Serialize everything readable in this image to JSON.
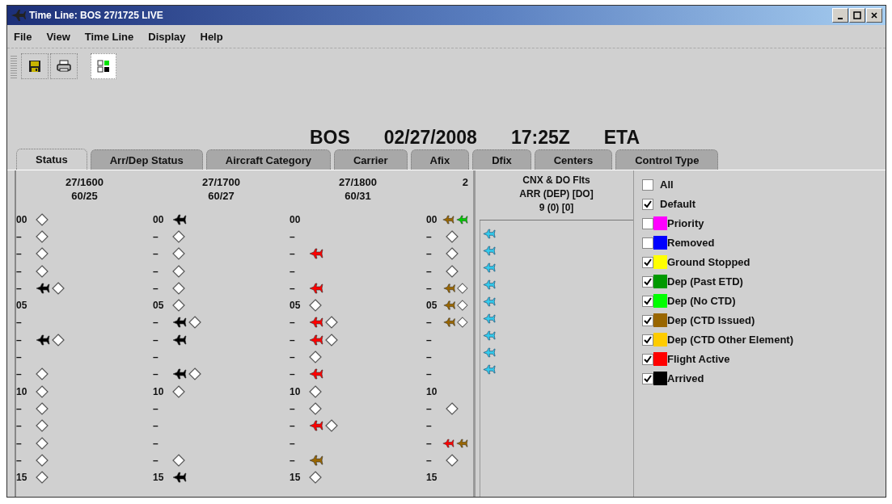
{
  "window": {
    "title": "Time Line: BOS 27/1725 LIVE"
  },
  "menu": [
    "File",
    "View",
    "Time Line",
    "Display",
    "Help"
  ],
  "header": [
    "BOS",
    "02/27/2008",
    "17:25Z",
    "ETA"
  ],
  "tabs": [
    {
      "label": "Status",
      "selected": true
    },
    {
      "label": "Arr/Dep Status",
      "selected": false
    },
    {
      "label": "Aircraft Category",
      "selected": false
    },
    {
      "label": "Carrier",
      "selected": false
    },
    {
      "label": "Afix",
      "selected": false
    },
    {
      "label": "Dfix",
      "selected": false
    },
    {
      "label": "Centers",
      "selected": false
    },
    {
      "label": "Control Type",
      "selected": false
    }
  ],
  "timeline": {
    "columns": [
      {
        "time": "27/1600",
        "count": "60/25",
        "rows": [
          {
            "label": "00",
            "marks": [
              {
                "kind": "diamond"
              }
            ]
          },
          {
            "label": "–",
            "marks": [
              {
                "kind": "diamond"
              }
            ]
          },
          {
            "label": "–",
            "marks": [
              {
                "kind": "diamond"
              }
            ]
          },
          {
            "label": "–",
            "marks": [
              {
                "kind": "diamond"
              }
            ]
          },
          {
            "label": "–",
            "marks": [
              {
                "kind": "plane",
                "color": "#000000"
              },
              {
                "kind": "diamond"
              }
            ]
          },
          {
            "label": "05",
            "marks": []
          },
          {
            "label": "–",
            "marks": []
          },
          {
            "label": "–",
            "marks": [
              {
                "kind": "plane",
                "color": "#000000"
              },
              {
                "kind": "diamond"
              }
            ]
          },
          {
            "label": "–",
            "marks": []
          },
          {
            "label": "–",
            "marks": [
              {
                "kind": "diamond"
              }
            ]
          },
          {
            "label": "10",
            "marks": [
              {
                "kind": "diamond"
              }
            ]
          },
          {
            "label": "–",
            "marks": [
              {
                "kind": "diamond"
              }
            ]
          },
          {
            "label": "–",
            "marks": [
              {
                "kind": "diamond"
              }
            ]
          },
          {
            "label": "–",
            "marks": [
              {
                "kind": "diamond"
              }
            ]
          },
          {
            "label": "–",
            "marks": [
              {
                "kind": "diamond"
              }
            ]
          },
          {
            "label": "15",
            "marks": [
              {
                "kind": "diamond"
              }
            ]
          }
        ]
      },
      {
        "time": "27/1700",
        "count": "60/27",
        "rows": [
          {
            "label": "00",
            "marks": [
              {
                "kind": "plane",
                "color": "#000000"
              }
            ]
          },
          {
            "label": "–",
            "marks": [
              {
                "kind": "diamond"
              }
            ]
          },
          {
            "label": "–",
            "marks": [
              {
                "kind": "diamond"
              }
            ]
          },
          {
            "label": "–",
            "marks": [
              {
                "kind": "diamond"
              }
            ]
          },
          {
            "label": "–",
            "marks": [
              {
                "kind": "diamond"
              }
            ]
          },
          {
            "label": "05",
            "marks": [
              {
                "kind": "diamond"
              }
            ]
          },
          {
            "label": "–",
            "marks": [
              {
                "kind": "plane",
                "color": "#000000"
              },
              {
                "kind": "diamond"
              }
            ]
          },
          {
            "label": "–",
            "marks": [
              {
                "kind": "plane",
                "color": "#000000"
              }
            ]
          },
          {
            "label": "–",
            "marks": []
          },
          {
            "label": "–",
            "marks": [
              {
                "kind": "plane",
                "color": "#000000"
              },
              {
                "kind": "diamond"
              }
            ]
          },
          {
            "label": "10",
            "marks": [
              {
                "kind": "diamond"
              }
            ]
          },
          {
            "label": "–",
            "marks": []
          },
          {
            "label": "–",
            "marks": []
          },
          {
            "label": "–",
            "marks": []
          },
          {
            "label": "–",
            "marks": [
              {
                "kind": "diamond"
              }
            ]
          },
          {
            "label": "15",
            "marks": [
              {
                "kind": "plane",
                "color": "#000000"
              }
            ]
          }
        ]
      },
      {
        "time": "27/1800",
        "count": "60/31",
        "rows": [
          {
            "label": "00",
            "marks": []
          },
          {
            "label": "–",
            "marks": []
          },
          {
            "label": "–",
            "marks": [
              {
                "kind": "plane",
                "color": "#ff0000"
              }
            ]
          },
          {
            "label": "–",
            "marks": []
          },
          {
            "label": "–",
            "marks": [
              {
                "kind": "plane",
                "color": "#ff0000"
              }
            ]
          },
          {
            "label": "05",
            "marks": [
              {
                "kind": "diamond"
              }
            ]
          },
          {
            "label": "–",
            "marks": [
              {
                "kind": "plane",
                "color": "#ff0000"
              },
              {
                "kind": "diamond"
              }
            ]
          },
          {
            "label": "–",
            "marks": [
              {
                "kind": "plane",
                "color": "#ff0000"
              },
              {
                "kind": "diamond"
              }
            ]
          },
          {
            "label": "–",
            "marks": [
              {
                "kind": "diamond"
              }
            ]
          },
          {
            "label": "–",
            "marks": [
              {
                "kind": "plane",
                "color": "#ff0000"
              }
            ]
          },
          {
            "label": "10",
            "marks": [
              {
                "kind": "diamond"
              }
            ]
          },
          {
            "label": "–",
            "marks": [
              {
                "kind": "diamond"
              }
            ]
          },
          {
            "label": "–",
            "marks": [
              {
                "kind": "plane",
                "color": "#ff0000"
              },
              {
                "kind": "diamond"
              }
            ]
          },
          {
            "label": "–",
            "marks": []
          },
          {
            "label": "–",
            "marks": [
              {
                "kind": "plane",
                "color": "#996600"
              }
            ]
          },
          {
            "label": "15",
            "marks": [
              {
                "kind": "diamond"
              }
            ]
          }
        ]
      },
      {
        "time": "2",
        "rows": [
          {
            "label": "00",
            "marks": [
              {
                "kind": "plane",
                "color": "#996600"
              },
              {
                "kind": "plane",
                "color": "#00cc00"
              }
            ]
          },
          {
            "label": "–",
            "marks": [
              {
                "kind": "diamond"
              }
            ]
          },
          {
            "label": "–",
            "marks": [
              {
                "kind": "diamond"
              }
            ]
          },
          {
            "label": "–",
            "marks": [
              {
                "kind": "diamond"
              }
            ]
          },
          {
            "label": "–",
            "marks": [
              {
                "kind": "plane",
                "color": "#996600"
              },
              {
                "kind": "diamond"
              }
            ]
          },
          {
            "label": "05",
            "marks": [
              {
                "kind": "plane",
                "color": "#996600"
              },
              {
                "kind": "diamond"
              }
            ]
          },
          {
            "label": "–",
            "marks": [
              {
                "kind": "plane",
                "color": "#996600"
              },
              {
                "kind": "diamond"
              }
            ]
          },
          {
            "label": "–",
            "marks": []
          },
          {
            "label": "–",
            "marks": []
          },
          {
            "label": "–",
            "marks": []
          },
          {
            "label": "10",
            "marks": []
          },
          {
            "label": "–",
            "marks": [
              {
                "kind": "diamond"
              }
            ]
          },
          {
            "label": "–",
            "marks": []
          },
          {
            "label": "–",
            "marks": [
              {
                "kind": "plane",
                "color": "#ff0000"
              },
              {
                "kind": "plane",
                "color": "#996600"
              }
            ]
          },
          {
            "label": "–",
            "marks": [
              {
                "kind": "diamond"
              }
            ]
          },
          {
            "label": "15",
            "marks": []
          }
        ]
      }
    ]
  },
  "cnx": {
    "title_lines": [
      "CNX & DO Flts",
      "ARR (DEP) [DO]",
      "9 (0) [0]"
    ],
    "flights": [
      {
        "kind": "arrival"
      },
      {
        "kind": "arrival"
      },
      {
        "kind": "arrival"
      },
      {
        "kind": "arrival"
      },
      {
        "kind": "arrival"
      },
      {
        "kind": "arrival"
      },
      {
        "kind": "arrival"
      },
      {
        "kind": "arrival"
      },
      {
        "kind": "arrival"
      }
    ]
  },
  "legend": [
    {
      "label": "All",
      "checked": false
    },
    {
      "label": "Default",
      "checked": true
    },
    {
      "label": "Priority",
      "checked": false,
      "color": "#ff00ff"
    },
    {
      "label": "Removed",
      "checked": false,
      "color": "#0000ff"
    },
    {
      "label": "Ground Stopped",
      "checked": true,
      "color": "#ffff00"
    },
    {
      "label": "Dep (Past ETD)",
      "checked": true,
      "color": "#009900"
    },
    {
      "label": "Dep (No CTD)",
      "checked": true,
      "color": "#00ff00"
    },
    {
      "label": "Dep (CTD Issued)",
      "checked": true,
      "color": "#996600"
    },
    {
      "label": "Dep (CTD Other Element)",
      "checked": true,
      "color": "#ffcc00"
    },
    {
      "label": "Flight Active",
      "checked": true,
      "color": "#ff0000"
    },
    {
      "label": "Arrived",
      "checked": true,
      "color": "#000000"
    }
  ]
}
